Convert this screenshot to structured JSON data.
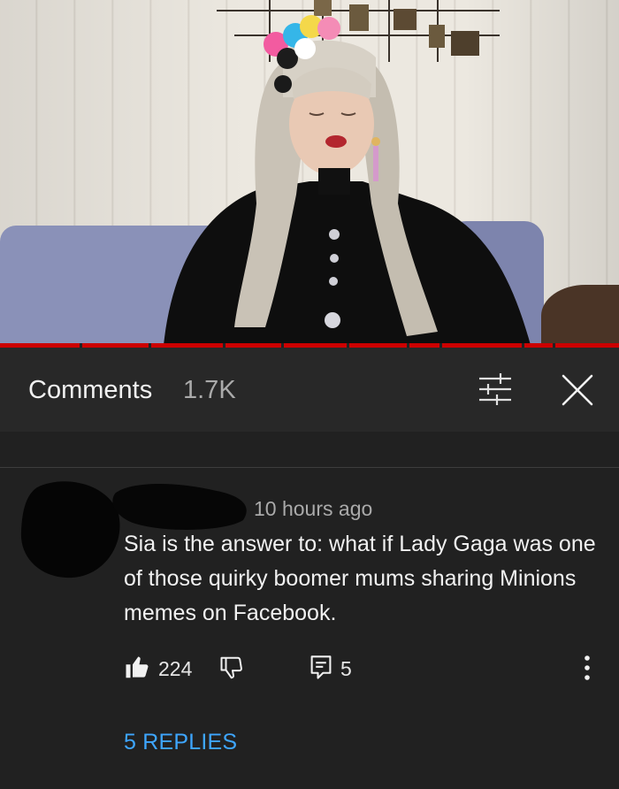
{
  "video": {
    "scene": "person-with-platinum-hair-and-colorful-hair-accessory-on-blue-sofa"
  },
  "comments_header": {
    "title": "Comments",
    "count": "1.7K",
    "filter_icon": "sliders-icon",
    "close_icon": "close-icon"
  },
  "comment": {
    "timestamp": "10 hours ago",
    "text": "Sia is the answer to: what if Lady Gaga was one of those quirky boomer mums sharing Minions memes on Facebook.",
    "likes": "224",
    "reply_count": "5",
    "replies_link": "5 REPLIES"
  },
  "colors": {
    "background": "#212121",
    "header_bg": "#282828",
    "progress": "#cc0000",
    "link": "#3ea6ff",
    "muted_text": "#aaaaaa"
  }
}
